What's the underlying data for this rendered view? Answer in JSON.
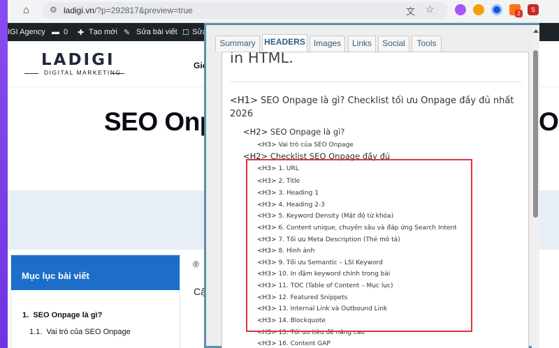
{
  "browser": {
    "url_host": "ladigi.vn",
    "url_path": "/?p=292817&preview=true",
    "ext_badge": "2",
    "ext_last": "S"
  },
  "adminbar": {
    "items": [
      {
        "label": "IGI Agency"
      },
      {
        "label": "0"
      },
      {
        "label": "Tạo mới"
      },
      {
        "label": "Sửa bài viết"
      },
      {
        "label": "Sửa"
      }
    ]
  },
  "site": {
    "logo_main": "LADIGI",
    "logo_sub": "DIGITAL MARKETING",
    "nav_item": "Gió",
    "hero_title": "SEO Onp",
    "hero_right": "O"
  },
  "toc": {
    "title": "Mục lục bài viết",
    "items": [
      {
        "num": "1.",
        "label": "SEO Onpage là gì?"
      },
      {
        "num": "1.1.",
        "label": "Vai trò của SEO Onpage"
      }
    ]
  },
  "article": {
    "author_icon": "®",
    "text": "Cậ"
  },
  "panel": {
    "tabs": [
      {
        "label": "Summary",
        "active": false
      },
      {
        "label": "HEADERS",
        "active": true
      },
      {
        "label": "Images",
        "active": false
      },
      {
        "label": "Links",
        "active": false
      },
      {
        "label": "Social",
        "active": false
      },
      {
        "label": "Tools",
        "active": false
      }
    ],
    "intro": "in HTML.",
    "h1": {
      "tag": "<H1>",
      "text": "SEO Onpage là gì? Checklist tối ưu Onpage đầy đủ nhất 2026"
    },
    "headings": [
      {
        "level": "H2",
        "tag": "<H2>",
        "text": "SEO Onpage là gì?"
      },
      {
        "level": "H3",
        "tag": "<H3>",
        "text": "Vai trò của SEO Onpage"
      },
      {
        "level": "H2",
        "tag": "<H2>",
        "text": "Checklist SEO Onpage đầy đủ"
      },
      {
        "level": "H3",
        "tag": "<H3>",
        "text": "1. URL"
      },
      {
        "level": "H3",
        "tag": "<H3>",
        "text": "2. Title"
      },
      {
        "level": "H3",
        "tag": "<H3>",
        "text": "3. Heading 1"
      },
      {
        "level": "H3",
        "tag": "<H3>",
        "text": "4. Heading 2-3"
      },
      {
        "level": "H3",
        "tag": "<H3>",
        "text": "5. Keyword Density (Mật độ từ khóa)"
      },
      {
        "level": "H3",
        "tag": "<H3>",
        "text": "6. Content unique, chuyên sâu và đáp ứng Search Intent"
      },
      {
        "level": "H3",
        "tag": "<H3>",
        "text": "7. Tối ưu Meta Description (Thẻ mô tả)"
      },
      {
        "level": "H3",
        "tag": "<H3>",
        "text": "8. Hình ảnh"
      },
      {
        "level": "H3",
        "tag": "<H3>",
        "text": "9. Tối ưu Semantic – LSI Keyword"
      },
      {
        "level": "H3",
        "tag": "<H3>",
        "text": "10. In đậm keyword chính trong bài"
      },
      {
        "level": "H3",
        "tag": "<H3>",
        "text": "11. TOC (Table of Content – Mục lục)"
      },
      {
        "level": "H3",
        "tag": "<H3>",
        "text": "12. Featured Snippets"
      },
      {
        "level": "H3",
        "tag": "<H3>",
        "text": "13. Internal Link và Outbound Link"
      },
      {
        "level": "H3",
        "tag": "<H3>",
        "text": "14. Blockquote"
      },
      {
        "level": "H3",
        "tag": "<H3>",
        "text": "15. Tối ưu tiêu đề nâng cao"
      },
      {
        "level": "H3",
        "tag": "<H3>",
        "text": "16. Content GAP"
      }
    ]
  },
  "colors": {
    "background": "#7c3aed",
    "panel_border": "#5b8fa8",
    "toc_header": "#1c6ec8",
    "highlight_box": "#e0353b"
  }
}
